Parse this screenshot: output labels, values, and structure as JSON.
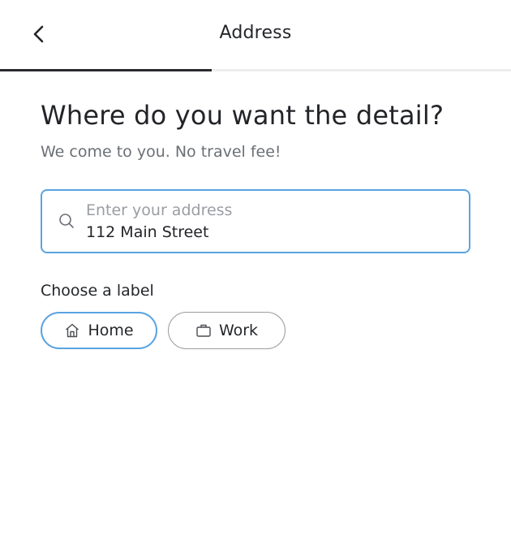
{
  "header": {
    "title": "Address",
    "back_icon": "chevron-left-icon",
    "progress_fraction": 0.415,
    "progress_color": "#2a2b2e",
    "track_color": "#ededee"
  },
  "main": {
    "title": "Where do you want the detail?",
    "subtitle": "We come to you. No travel fee!",
    "address": {
      "search_icon": "search-icon",
      "placeholder": "Enter your address",
      "value": "112 Main Street",
      "focus_color": "#5aa3e2"
    },
    "label_heading": "Choose a label",
    "labels": [
      {
        "label": "Home",
        "icon": "home-icon",
        "selected": true
      },
      {
        "label": "Work",
        "icon": "briefcase-icon",
        "selected": false
      }
    ]
  }
}
